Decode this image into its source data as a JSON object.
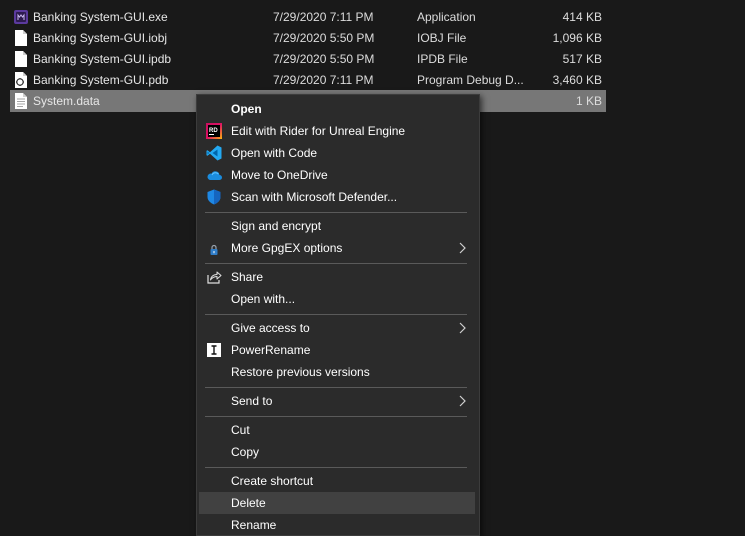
{
  "files": [
    {
      "name": "Banking System-GUI.exe",
      "date": "7/29/2020 7:11 PM",
      "type": "Application",
      "size": "414 KB",
      "icon": "app-exe-icon"
    },
    {
      "name": "Banking System-GUI.iobj",
      "date": "7/29/2020 5:50 PM",
      "type": "IOBJ File",
      "size": "1,096 KB",
      "icon": "file-icon"
    },
    {
      "name": "Banking System-GUI.ipdb",
      "date": "7/29/2020 5:50 PM",
      "type": "IPDB File",
      "size": "517 KB",
      "icon": "file-icon"
    },
    {
      "name": "Banking System-GUI.pdb",
      "date": "7/29/2020 7:11 PM",
      "type": "Program Debug D...",
      "size": "3,460 KB",
      "icon": "pdb-file-icon"
    },
    {
      "name": "System.data",
      "date": "",
      "type": "",
      "size": "1 KB",
      "icon": "text-file-icon",
      "selected": true
    }
  ],
  "menu": {
    "open": "Open",
    "rider": "Edit with Rider for Unreal Engine",
    "code": "Open with Code",
    "onedrive": "Move to OneDrive",
    "defender": "Scan with Microsoft Defender...",
    "sign": "Sign and encrypt",
    "gpgex": "More GpgEX options",
    "share": "Share",
    "open_with": "Open with...",
    "give_access": "Give access to",
    "powerrename": "PowerRename",
    "restore": "Restore previous versions",
    "send_to": "Send to",
    "cut": "Cut",
    "copy": "Copy",
    "create_shortcut": "Create shortcut",
    "delete": "Delete",
    "rename": "Rename"
  },
  "colors": {
    "background": "#191919",
    "menu_background": "#2b2b2b",
    "selection": "#777777",
    "hover": "#414141",
    "vscode_blue": "#23a9f2",
    "onedrive_blue": "#1a8cde",
    "defender_blue": "#1e88e5"
  }
}
